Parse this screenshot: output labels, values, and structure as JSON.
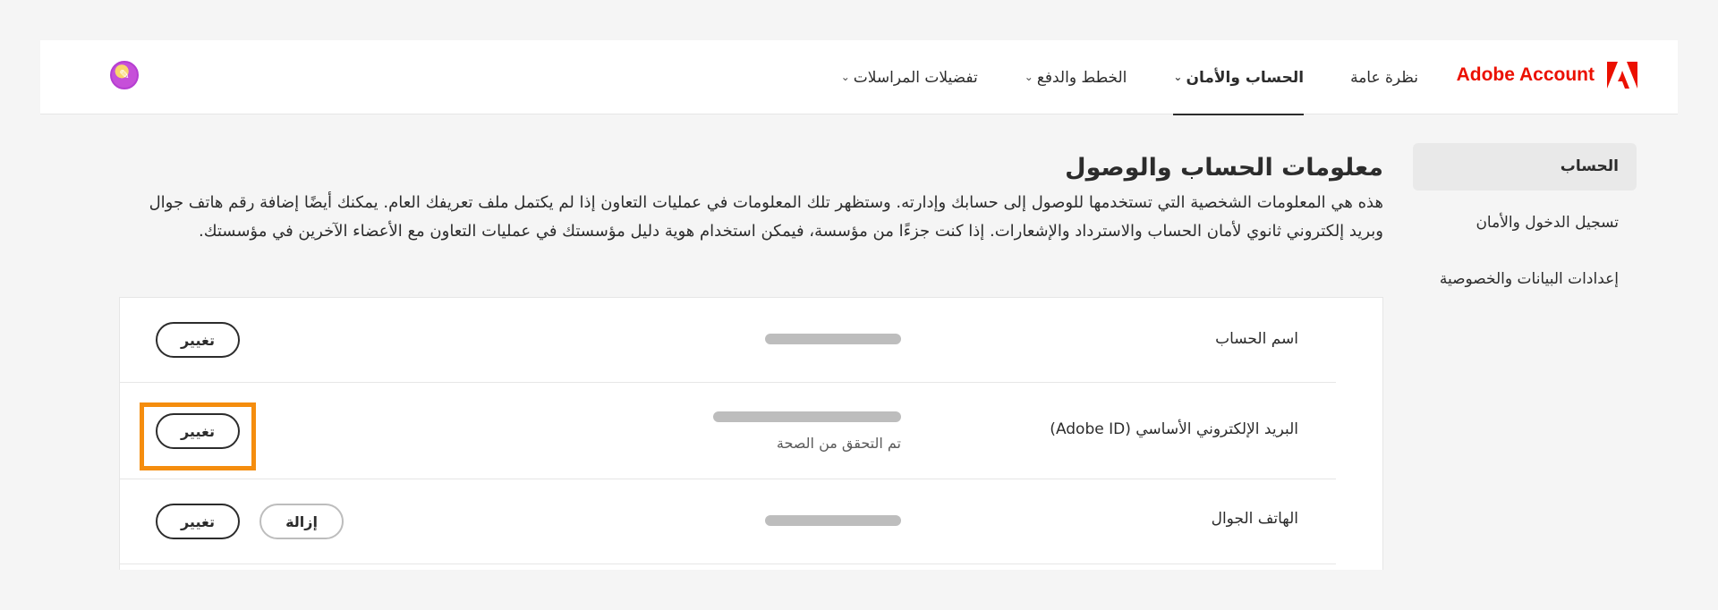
{
  "brand": {
    "name": "Adobe Account"
  },
  "nav": {
    "items": [
      {
        "label": "نظرة عامة",
        "dropdown": false,
        "active": false
      },
      {
        "label": "الحساب والأمان",
        "dropdown": true,
        "active": true
      },
      {
        "label": "الخطط والدفع",
        "dropdown": true,
        "active": false
      },
      {
        "label": "تفضيلات المراسلات",
        "dropdown": true,
        "active": false
      }
    ]
  },
  "sidebar": {
    "items": [
      {
        "label": "الحساب",
        "active": true
      },
      {
        "label": "تسجيل الدخول والأمان",
        "active": false
      },
      {
        "label": "إعدادات البيانات والخصوصية",
        "active": false
      }
    ]
  },
  "main": {
    "title": "معلومات الحساب والوصول",
    "description": "هذه هي المعلومات الشخصية التي تستخدمها للوصول إلى حسابك وإدارته. وستظهر تلك المعلومات في عمليات التعاون إذا لم يكتمل ملف تعريفك العام. يمكنك أيضًا إضافة رقم هاتف جوال وبريد إلكتروني ثانوي لأمان الحساب والاسترداد والإشعارات. إذا كنت جزءًا من مؤسسة، فيمكن استخدام هوية دليل مؤسستك في عمليات التعاون مع الأعضاء الآخرين في مؤسستك."
  },
  "rows": {
    "account_name": {
      "label": "اسم الحساب",
      "change": "تغيير"
    },
    "email": {
      "label": "البريد الإلكتروني الأساسي (Adobe ID)",
      "status": "تم التحقق من الصحة",
      "change": "تغيير"
    },
    "mobile": {
      "label": "الهاتف الجوال",
      "remove": "إزالة",
      "change": "تغيير"
    }
  },
  "colors": {
    "brand": "#eb1000",
    "highlight": "#f58d0e"
  },
  "icons": {
    "logo": "adobe-logo-icon",
    "avatar": "user-avatar",
    "dropdown": "chevron-down-icon"
  }
}
